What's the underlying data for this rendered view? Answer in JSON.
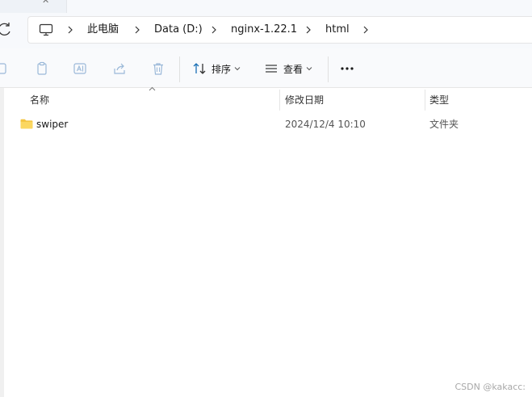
{
  "breadcrumb": {
    "root_icon": "computer-icon",
    "items": [
      "此电脑",
      "Data (D:)",
      "nginx-1.22.1",
      "html"
    ]
  },
  "toolbar": {
    "sort_label": "排序",
    "view_label": "查看",
    "more_label": "···"
  },
  "columns": {
    "name": "名称",
    "date": "修改日期",
    "type": "类型"
  },
  "files": [
    {
      "name": "swiper",
      "icon": "folder-icon",
      "modified": "2024/12/4 10:10",
      "type": "文件夹"
    }
  ],
  "watermark": "CSDN @kakacc:",
  "colors": {
    "accent": "#0067c0",
    "folder": "#f7c948",
    "toolbar_bg": "#f9fafc"
  }
}
